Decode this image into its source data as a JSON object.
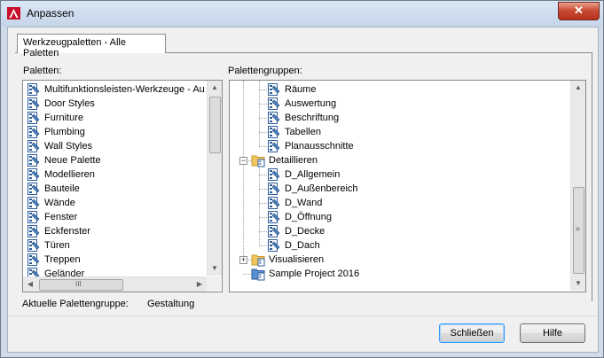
{
  "window": {
    "title": "Anpassen",
    "close_label": "✕"
  },
  "tabs": [
    {
      "label": "Werkzeugpaletten - Alle Paletten"
    }
  ],
  "palettes": {
    "label": "Paletten:",
    "items": [
      "Multifunktionsleisten-Werkzeuge - Au",
      "Door Styles",
      "Furniture",
      "Plumbing",
      "Wall Styles",
      "Neue Palette",
      "Modellieren",
      "Bauteile",
      "Wände",
      "Fenster",
      "Eckfenster",
      "Türen",
      "Treppen",
      "Geländer"
    ],
    "hscroll_grip": "III"
  },
  "groups": {
    "label": "Palettengruppen:",
    "items": [
      {
        "label": "Räume",
        "level": 2,
        "kind": "palette"
      },
      {
        "label": "Auswertung",
        "level": 2,
        "kind": "palette"
      },
      {
        "label": "Beschriftung",
        "level": 2,
        "kind": "palette"
      },
      {
        "label": "Tabellen",
        "level": 2,
        "kind": "palette"
      },
      {
        "label": "Planausschnitte",
        "level": 2,
        "kind": "palette"
      },
      {
        "label": "Detaillieren",
        "level": 1,
        "kind": "group",
        "expanded": true
      },
      {
        "label": "D_Allgemein",
        "level": 2,
        "kind": "palette"
      },
      {
        "label": "D_Außenbereich",
        "level": 2,
        "kind": "palette"
      },
      {
        "label": "D_Wand",
        "level": 2,
        "kind": "palette"
      },
      {
        "label": "D_Öffnung",
        "level": 2,
        "kind": "palette"
      },
      {
        "label": "D_Decke",
        "level": 2,
        "kind": "palette"
      },
      {
        "label": "D_Dach",
        "level": 2,
        "kind": "palette"
      },
      {
        "label": "Visualisieren",
        "level": 1,
        "kind": "group",
        "expanded": false
      },
      {
        "label": "Sample Project 2016",
        "level": 1,
        "kind": "group-blue",
        "expanded": null
      }
    ]
  },
  "status": {
    "label": "Aktuelle Palettengruppe:",
    "value": "Gestaltung"
  },
  "buttons": {
    "close": "Schließen",
    "help": "Hilfe"
  },
  "icons": {
    "palette": "palette-icon",
    "group": "folder-icon"
  }
}
